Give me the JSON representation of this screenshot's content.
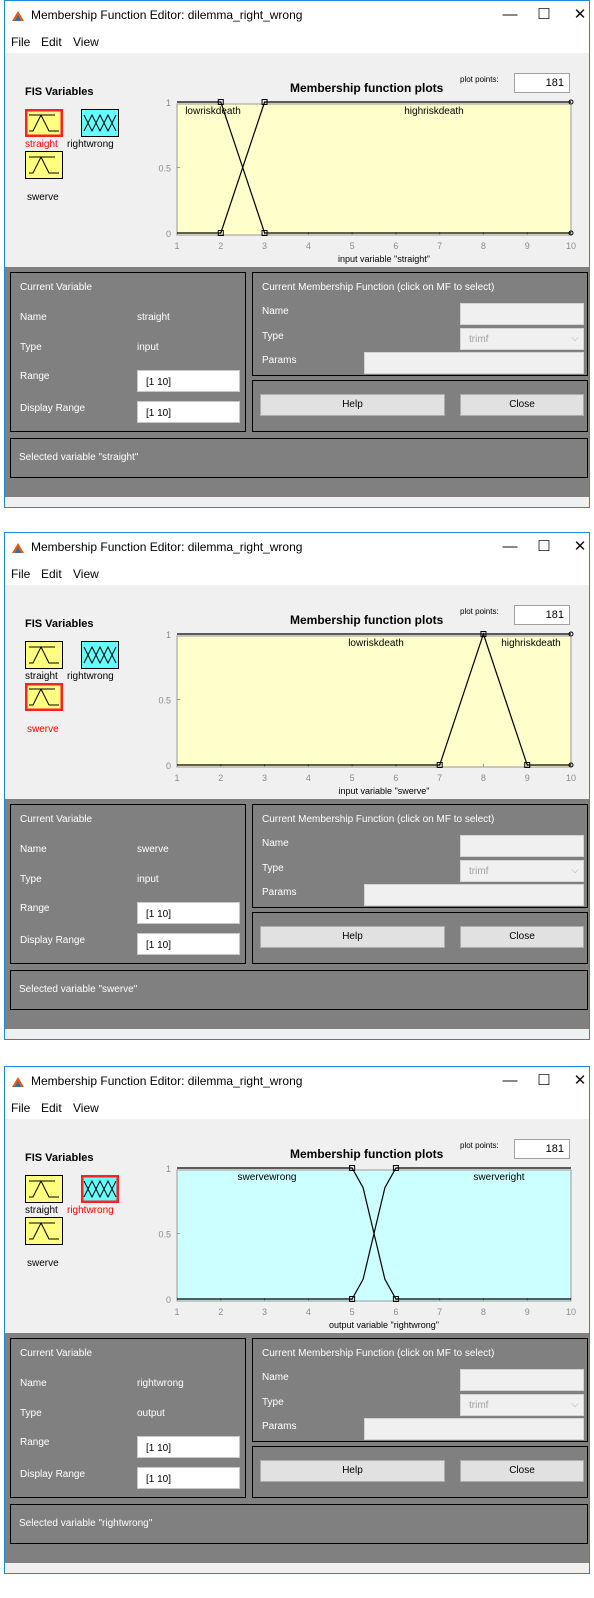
{
  "windows": [
    {
      "title": "Membership Function Editor: dilemma_right_wrong",
      "controls": {
        "minimize": "—",
        "maximize": "☐",
        "close": "✕"
      },
      "menu": [
        "File",
        "Edit",
        "View"
      ],
      "fis_panel": {
        "label": "FIS Variables",
        "variables": [
          {
            "name": "straight",
            "kind": "input",
            "selected": true
          },
          {
            "name": "rightwrong",
            "kind": "output",
            "selected": false
          },
          {
            "name": "swerve",
            "kind": "input",
            "selected": false
          }
        ]
      },
      "plot": {
        "title": "Membership function plots",
        "plot_points_label": "plot points:",
        "plot_points_value": "181",
        "xlabel": "input variable \"straight\"",
        "bg_color": "#ffffcc",
        "xticks": [
          "1",
          "2",
          "3",
          "4",
          "5",
          "6",
          "7",
          "8",
          "9",
          "10"
        ],
        "yticks": [
          "0",
          "0.5",
          "1"
        ],
        "mf_labels": [
          "lowriskdeath",
          "highriskdeath"
        ]
      },
      "current_variable": {
        "header": "Current Variable",
        "name_label": "Name",
        "name_value": "straight",
        "type_label": "Type",
        "type_value": "input",
        "range_label": "Range",
        "range_value": "[1 10]",
        "display_range_label": "Display Range",
        "display_range_value": "[1 10]"
      },
      "current_mf": {
        "header": "Current Membership Function (click on MF to select)",
        "name_label": "Name",
        "name_value": "",
        "type_label": "Type",
        "type_value": "trimf",
        "params_label": "Params",
        "params_value": ""
      },
      "buttons": {
        "help": "Help",
        "close": "Close"
      },
      "status": "Selected variable \"straight\"",
      "chart_data": {
        "type": "line",
        "x_range": [
          1,
          10
        ],
        "ylim": [
          0,
          1
        ],
        "series": [
          {
            "name": "lowriskdeath",
            "mf": "trimf",
            "points": [
              [
                1,
                1
              ],
              [
                2,
                1
              ],
              [
                3,
                0
              ],
              [
                10,
                0
              ]
            ]
          },
          {
            "name": "highriskdeath",
            "mf": "trimf",
            "points": [
              [
                1,
                0
              ],
              [
                2,
                0
              ],
              [
                3,
                1
              ],
              [
                10,
                1
              ]
            ]
          }
        ]
      }
    },
    {
      "title": "Membership Function Editor: dilemma_right_wrong",
      "controls": {
        "minimize": "—",
        "maximize": "☐",
        "close": "✕"
      },
      "menu": [
        "File",
        "Edit",
        "View"
      ],
      "fis_panel": {
        "label": "FIS Variables",
        "variables": [
          {
            "name": "straight",
            "kind": "input",
            "selected": false
          },
          {
            "name": "rightwrong",
            "kind": "output",
            "selected": false
          },
          {
            "name": "swerve",
            "kind": "input",
            "selected": true
          }
        ]
      },
      "plot": {
        "title": "Membership function plots",
        "plot_points_label": "plot points:",
        "plot_points_value": "181",
        "xlabel": "input variable \"swerve\"",
        "bg_color": "#ffffcc",
        "xticks": [
          "1",
          "2",
          "3",
          "4",
          "5",
          "6",
          "7",
          "8",
          "9",
          "10"
        ],
        "yticks": [
          "0",
          "0.5",
          "1"
        ],
        "mf_labels": [
          "lowriskdeath",
          "highriskdeath"
        ]
      },
      "current_variable": {
        "header": "Current Variable",
        "name_label": "Name",
        "name_value": "swerve",
        "type_label": "Type",
        "type_value": "input",
        "range_label": "Range",
        "range_value": "[1 10]",
        "display_range_label": "Display Range",
        "display_range_value": "[1 10]"
      },
      "current_mf": {
        "header": "Current Membership Function (click on MF to select)",
        "name_label": "Name",
        "name_value": "",
        "type_label": "Type",
        "type_value": "trimf",
        "params_label": "Params",
        "params_value": ""
      },
      "buttons": {
        "help": "Help",
        "close": "Close"
      },
      "status": "Selected variable \"swerve\"",
      "chart_data": {
        "type": "line",
        "x_range": [
          1,
          10
        ],
        "ylim": [
          0,
          1
        ],
        "series": [
          {
            "name": "lowriskdeath",
            "mf": "trimf",
            "points": [
              [
                1,
                1
              ],
              [
                10,
                1
              ]
            ]
          },
          {
            "name": "highriskdeath",
            "mf": "trimf",
            "points": [
              [
                1,
                0
              ],
              [
                7,
                0
              ],
              [
                8,
                1
              ],
              [
                9,
                0
              ],
              [
                10,
                0
              ]
            ]
          }
        ]
      }
    },
    {
      "title": "Membership Function Editor: dilemma_right_wrong",
      "controls": {
        "minimize": "—",
        "maximize": "☐",
        "close": "✕"
      },
      "menu": [
        "File",
        "Edit",
        "View"
      ],
      "fis_panel": {
        "label": "FIS Variables",
        "variables": [
          {
            "name": "straight",
            "kind": "input",
            "selected": false
          },
          {
            "name": "rightwrong",
            "kind": "output",
            "selected": true
          },
          {
            "name": "swerve",
            "kind": "input",
            "selected": false
          }
        ]
      },
      "plot": {
        "title": "Membership function plots",
        "plot_points_label": "plot points:",
        "plot_points_value": "181",
        "xlabel": "output variable \"rightwrong\"",
        "bg_color": "#ccffff",
        "xticks": [
          "1",
          "2",
          "3",
          "4",
          "5",
          "6",
          "7",
          "8",
          "9",
          "10"
        ],
        "yticks": [
          "0",
          "0.5",
          "1"
        ],
        "mf_labels": [
          "swervewrong",
          "swerveright"
        ]
      },
      "current_variable": {
        "header": "Current Variable",
        "name_label": "Name",
        "name_value": "rightwrong",
        "type_label": "Type",
        "type_value": "output",
        "range_label": "Range",
        "range_value": "[1 10]",
        "display_range_label": "Display Range",
        "display_range_value": "[1 10]"
      },
      "current_mf": {
        "header": "Current Membership Function (click on MF to select)",
        "name_label": "Name",
        "name_value": "",
        "type_label": "Type",
        "type_value": "trimf",
        "params_label": "Params",
        "params_value": ""
      },
      "buttons": {
        "help": "Help",
        "close": "Close"
      },
      "status": "Selected variable \"rightwrong\"",
      "chart_data": {
        "type": "line",
        "x_range": [
          1,
          10
        ],
        "ylim": [
          0,
          1
        ],
        "series": [
          {
            "name": "swervewrong",
            "mf": "smooth",
            "points": [
              [
                1,
                1
              ],
              [
                5,
                1
              ],
              [
                5.25,
                0.85
              ],
              [
                5.5,
                0.5
              ],
              [
                5.75,
                0.15
              ],
              [
                6,
                0
              ],
              [
                10,
                0
              ]
            ]
          },
          {
            "name": "swerveright",
            "mf": "smooth",
            "points": [
              [
                1,
                0
              ],
              [
                5,
                0
              ],
              [
                5.25,
                0.15
              ],
              [
                5.5,
                0.5
              ],
              [
                5.75,
                0.85
              ],
              [
                6,
                1
              ],
              [
                10,
                1
              ]
            ]
          }
        ]
      }
    }
  ]
}
